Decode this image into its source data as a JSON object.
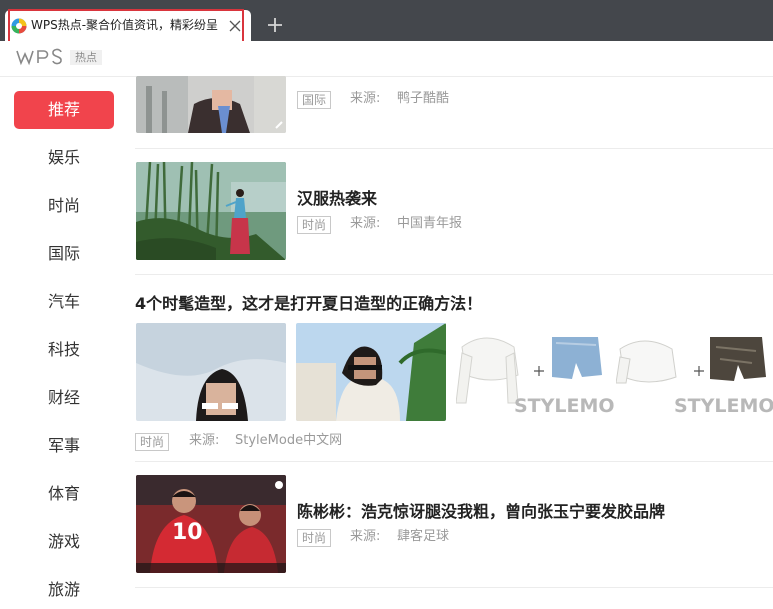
{
  "browser": {
    "tab_title": "WPS热点-聚合价值资讯，精彩纷呈",
    "new_tab_symbol": "+"
  },
  "app": {
    "logo_text": "WPS",
    "badge": "热点"
  },
  "sidebar": {
    "items": [
      {
        "label": "推荐",
        "active": true
      },
      {
        "label": "娱乐",
        "active": false
      },
      {
        "label": "时尚",
        "active": false
      },
      {
        "label": "国际",
        "active": false
      },
      {
        "label": "汽车",
        "active": false
      },
      {
        "label": "科技",
        "active": false
      },
      {
        "label": "财经",
        "active": false
      },
      {
        "label": "军事",
        "active": false
      },
      {
        "label": "体育",
        "active": false
      },
      {
        "label": "游戏",
        "active": false
      },
      {
        "label": "旅游",
        "active": false
      }
    ]
  },
  "feed": {
    "source_label": "来源:",
    "items": [
      {
        "title": "",
        "tag": "国际",
        "source": "鸭子酷酷"
      },
      {
        "title": "汉服热袭来",
        "tag": "时尚",
        "source": "中国青年报"
      },
      {
        "title": "4个时髦造型，这才是打开夏日造型的正确方法！",
        "tag": "时尚",
        "source": "StyleMode中文网",
        "watermark": "STYLEMO",
        "plus_symbol": "+"
      },
      {
        "title": "陈彬彬：浩克惊讶腿没我粗，曾向张玉宁要发胶品牌",
        "tag": "时尚",
        "source": "肆客足球",
        "jersey_number": "10"
      }
    ]
  },
  "colors": {
    "tabbar": "#44474c",
    "accent": "#f1444c",
    "highlight_box": "#d9353d"
  }
}
